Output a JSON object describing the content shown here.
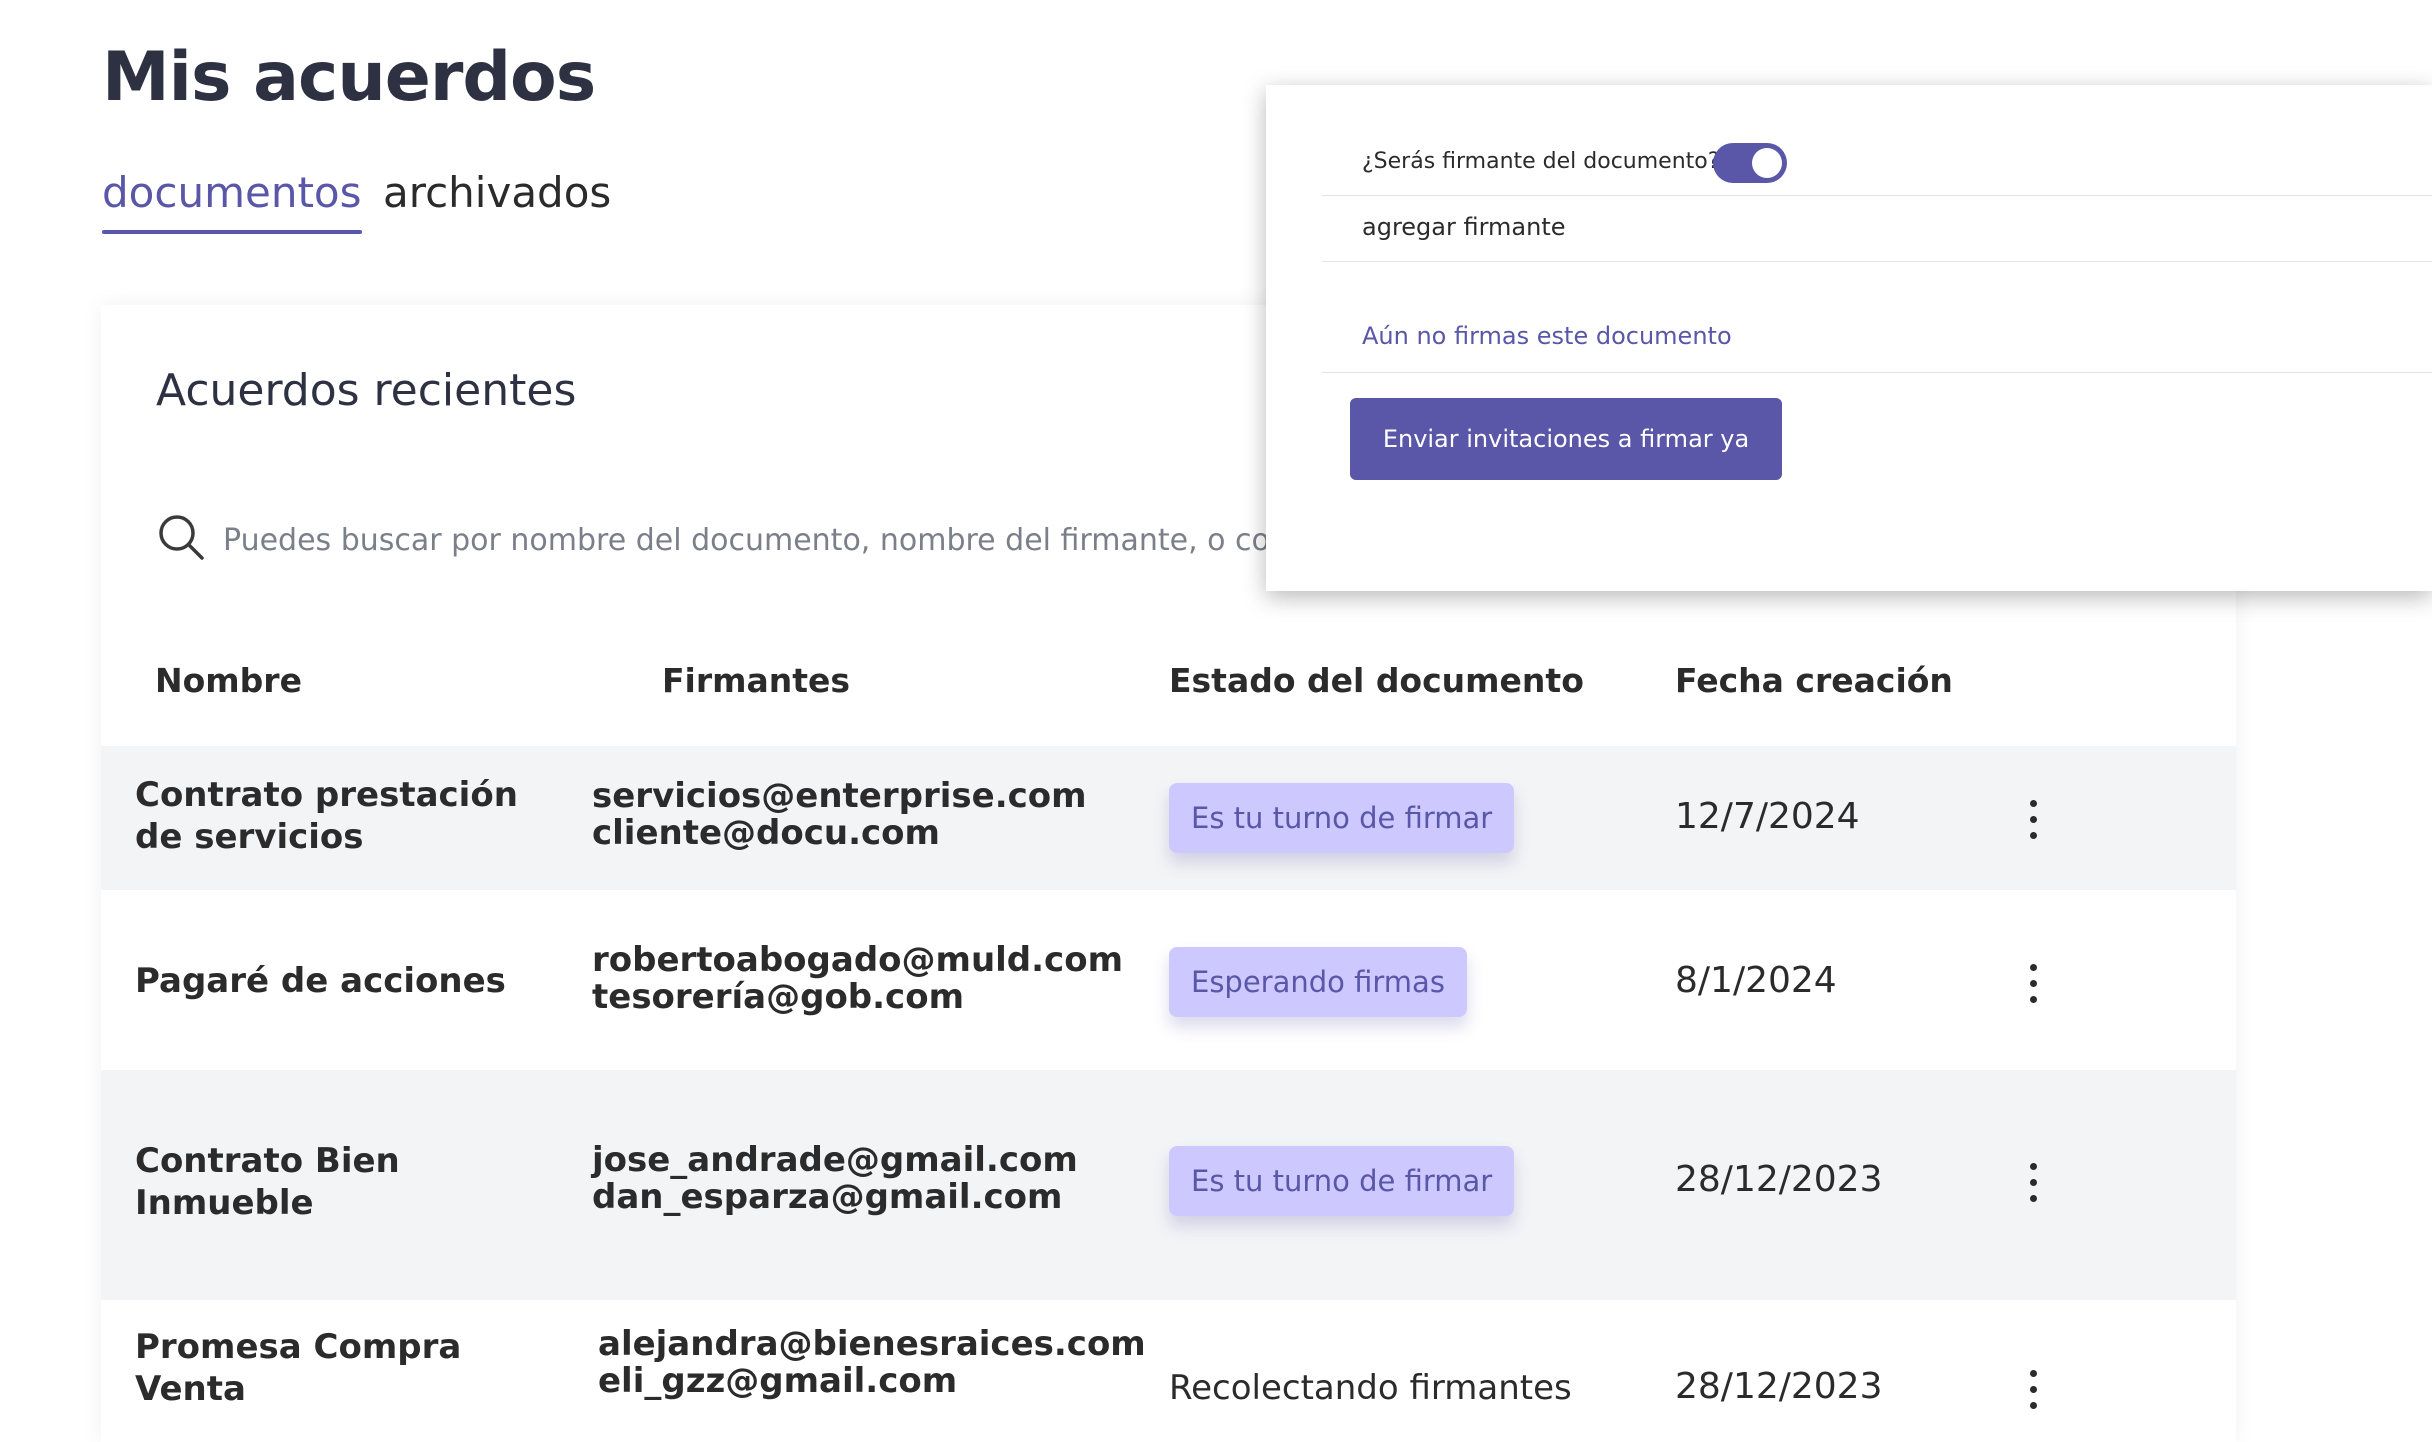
{
  "header": {
    "title": "Mis acuerdos"
  },
  "tabs": [
    {
      "label": "documentos",
      "active": true
    },
    {
      "label": "archivados",
      "active": false
    }
  ],
  "card": {
    "title": "Acuerdos recientes",
    "search_placeholder": "Puedes buscar por nombre del documento, nombre del firmante, o correo del firmante"
  },
  "table": {
    "columns": [
      "Nombre",
      "Firmantes",
      "Estado del documento",
      "Fecha creación"
    ],
    "rows": [
      {
        "name_lines": [
          "Contrato prestación",
          "de servicios"
        ],
        "signers": [
          "servicios@enterprise.com",
          "cliente@docu.com"
        ],
        "status": "Es tu turno de firmar",
        "status_style": "badge",
        "date": "12/7/2024"
      },
      {
        "name_lines": [
          "Pagaré de acciones"
        ],
        "signers": [
          "robertoabogado@muld.com",
          "tesorería@gob.com"
        ],
        "status": "Esperando firmas",
        "status_style": "badge",
        "date": "8/1/2024"
      },
      {
        "name_lines": [
          "Contrato Bien",
          "Inmueble"
        ],
        "signers": [
          "jose_andrade@gmail.com",
          "dan_esparza@gmail.com"
        ],
        "status": "Es tu turno de firmar",
        "status_style": "badge",
        "date": "28/12/2023"
      },
      {
        "name_lines": [
          "Promesa Compra",
          "Venta"
        ],
        "signers": [
          "alejandra@bienesraices.com",
          "eli_gzz@gmail.com"
        ],
        "status": "Recolectando firmantes",
        "status_style": "plain",
        "date": "28/12/2023"
      }
    ]
  },
  "popup": {
    "signer_question": "¿Serás firmante del documento?",
    "signer_toggle_on": true,
    "add_signer_label": "agregar firmante",
    "not_signed_text": "Aún no firmas este documento",
    "send_button_label": "Enviar invitaciones a firmar ya"
  },
  "colors": {
    "accent": "#5a56a8",
    "badge_bg": "#cdc9ff",
    "row_shade": "#f3f4f6",
    "title": "#2d3142"
  },
  "icons": {
    "search": "search-icon",
    "row_menu": "more-vertical-icon"
  }
}
